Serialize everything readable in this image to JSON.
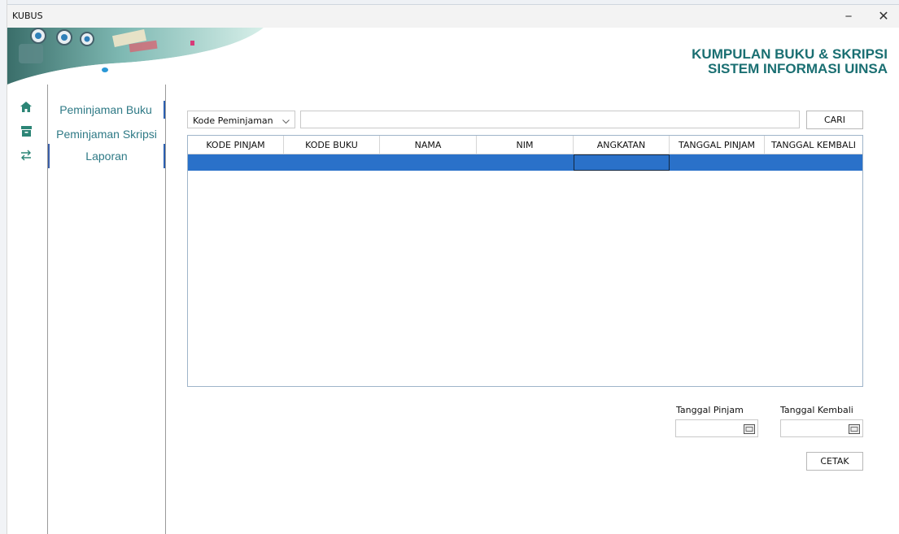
{
  "window": {
    "title": "KUBUS",
    "minimize_label": "−",
    "close_label": "✕"
  },
  "banner": {
    "line1": "KUMPULAN BUKU & SKRIPSI",
    "line2": "SISTEM INFORMASI UINSA",
    "brand_color": "#1a6f72"
  },
  "icon_rail": {
    "icons": [
      "home-icon",
      "archive-icon",
      "swap-arrows-icon"
    ]
  },
  "nav": {
    "items": [
      {
        "label": "Peminjaman Buku"
      },
      {
        "label": "Peminjaman Skripsi"
      },
      {
        "label": "Laporan"
      }
    ]
  },
  "search": {
    "filter_selected": "Kode Peminjaman",
    "query": "",
    "button_label": "CARI"
  },
  "table": {
    "columns": [
      "KODE PINJAM",
      "KODE BUKU",
      "NAMA",
      "NIM",
      "ANGKATAN",
      "TANGGAL PINJAM",
      "TANGGAL KEMBALI"
    ],
    "selected_row_color": "#2a71c9"
  },
  "filters": {
    "tanggal_pinjam_label": "Tanggal Pinjam",
    "tanggal_pinjam_value": "",
    "tanggal_kembali_label": "Tanggal Kembali",
    "tanggal_kembali_value": ""
  },
  "actions": {
    "print_label": "CETAK"
  }
}
